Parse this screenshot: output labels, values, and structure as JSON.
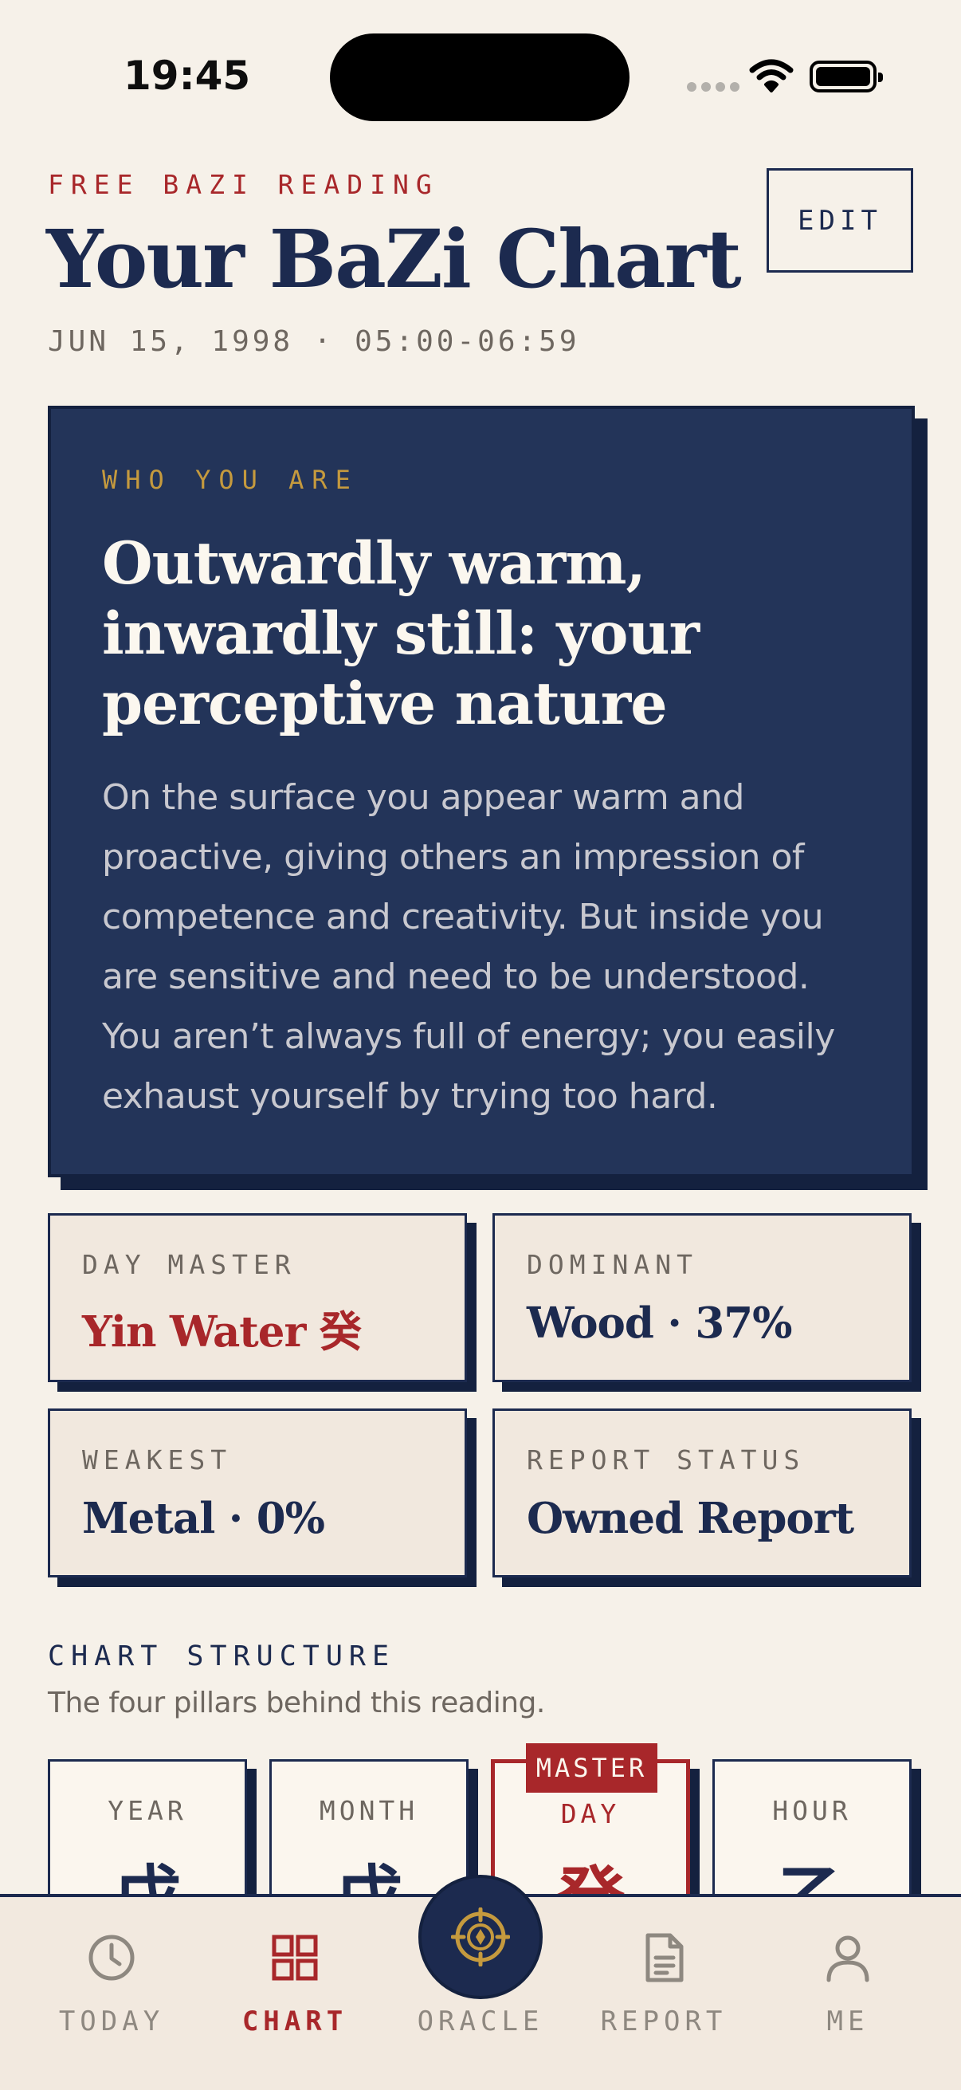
{
  "status_bar": {
    "time": "19:45"
  },
  "header": {
    "eyebrow": "FREE BAZI READING",
    "title": "Your BaZi Chart",
    "date_line": "JUN 15, 1998 · 05:00-06:59",
    "edit_label": "EDIT"
  },
  "hero": {
    "eyebrow": "WHO YOU ARE",
    "title": "Outwardly warm, inwardly still: your perceptive nature",
    "body": "On the surface you appear warm and proactive, giving others an impression of competence and creativity. But inside you are sensitive and need to be understood. You aren’t always full of energy; you easily exhaust yourself by trying too hard."
  },
  "stats": [
    {
      "label": "DAY MASTER",
      "value": "Yin Water 癸"
    },
    {
      "label": "DOMINANT",
      "value": "Wood · 37%"
    },
    {
      "label": "WEAKEST",
      "value": "Metal · 0%"
    },
    {
      "label": "REPORT STATUS",
      "value": "Owned Report"
    }
  ],
  "chart_structure": {
    "title": "CHART STRUCTURE",
    "subtitle": "The four pillars behind this reading.",
    "master_badge": "MASTER",
    "pillars": [
      {
        "label": "YEAR",
        "char": "戊"
      },
      {
        "label": "MONTH",
        "char": "戊"
      },
      {
        "label": "DAY",
        "char": "癸"
      },
      {
        "label": "HOUR",
        "char": "乙"
      }
    ]
  },
  "tabs": [
    {
      "label": "TODAY",
      "icon": "clock-icon"
    },
    {
      "label": "CHART",
      "icon": "grid-icon"
    },
    {
      "label": "ORACLE",
      "icon": "compass-icon"
    },
    {
      "label": "REPORT",
      "icon": "document-icon"
    },
    {
      "label": "ME",
      "icon": "person-icon"
    }
  ],
  "colors": {
    "background": "#f6f1e9",
    "navy": "#1c2a4f",
    "accent_red": "#a8272a",
    "gold": "#c59a3e"
  }
}
